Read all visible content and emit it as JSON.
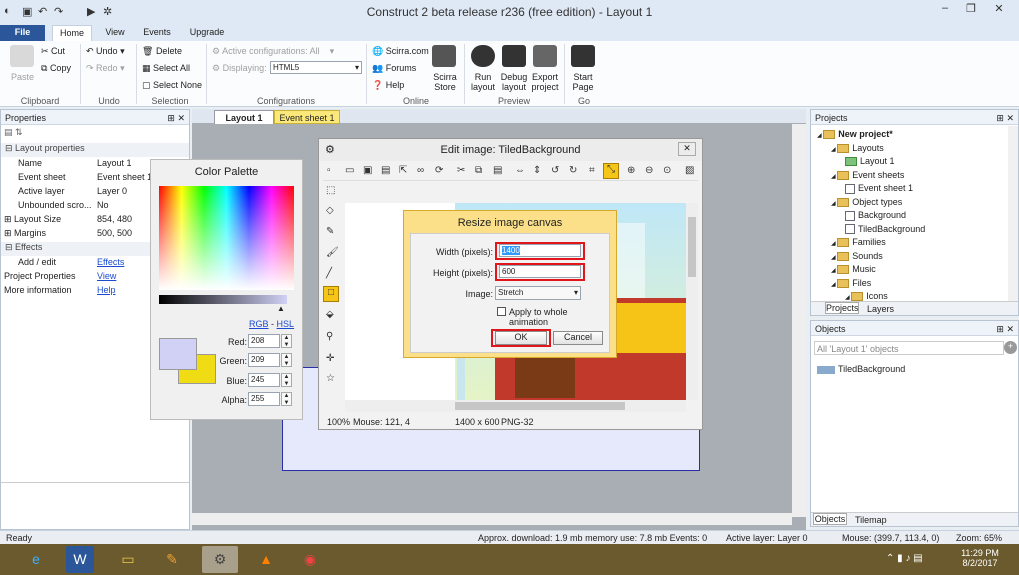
{
  "window": {
    "title": "Construct 2 beta release r236  (free edition) - Layout 1",
    "min": "–",
    "max": "❐",
    "close": "✕"
  },
  "menu_tabs": [
    "File",
    "Home",
    "View",
    "Events",
    "Upgrade"
  ],
  "ribbon": {
    "clipboard": {
      "paste": "Paste",
      "cut": "Cut",
      "copy": "Copy",
      "group": "Clipboard"
    },
    "undo": {
      "undo": "Undo",
      "redo": "Redo",
      "group": "Undo"
    },
    "selection": {
      "delete": "Delete",
      "select_all": "Select All",
      "select_none": "Select None",
      "group": "Selection"
    },
    "configurations": {
      "active_label": "Active configurations: All",
      "displaying_label": "Displaying:",
      "displaying_value": "HTML5",
      "group": "Configurations"
    },
    "online": {
      "scirra": "Scirra.com",
      "forums": "Forums",
      "help": "Help",
      "store": "Scirra Store",
      "group": "Online"
    },
    "preview": {
      "run": "Run layout",
      "debug": "Debug layout",
      "export": "Export project",
      "group": "Preview"
    },
    "go": {
      "start": "Start Page",
      "group": "Go"
    }
  },
  "properties": {
    "header": "Properties",
    "section_layout": "Layout properties",
    "rows": [
      {
        "name": "Name",
        "value": "Layout 1"
      },
      {
        "name": "Event sheet",
        "value": "Event sheet 1"
      },
      {
        "name": "Active layer",
        "value": "Layer 0"
      },
      {
        "name": "Unbounded scro...",
        "value": "No"
      },
      {
        "name": "Layout Size",
        "value": "854, 480"
      },
      {
        "name": "Margins",
        "value": "500, 500"
      }
    ],
    "section_effects": "Effects",
    "add_edit": "Add / edit",
    "effects_link": "Effects",
    "project_props": "Project Properties",
    "view_link": "View",
    "more_info": "More information",
    "help_link": "Help"
  },
  "doc_tabs": [
    "Layout 1",
    "Event sheet 1"
  ],
  "color_palette": {
    "title": "Color Palette",
    "rgb_link": "RGB",
    "sep": "-",
    "hsl_link": "HSL",
    "red_label": "Red:",
    "red": "208",
    "green_label": "Green:",
    "green": "209",
    "blue_label": "Blue:",
    "blue": "245",
    "alpha_label": "Alpha:",
    "alpha": "255",
    "primary_color": "#d0d1f5",
    "secondary_color": "#f0dc14"
  },
  "edit_image": {
    "title": "Edit image: TiledBackground",
    "status_zoom": "100%",
    "status_mouse": "Mouse: 121, 4",
    "status_size": "1400 x 600",
    "status_format": "PNG-32"
  },
  "resize_dialog": {
    "title": "Resize image canvas",
    "width_label": "Width (pixels):",
    "width_value": "1400",
    "height_label": "Height (pixels):",
    "height_value": "600",
    "image_label": "Image:",
    "image_value": "Stretch",
    "apply_anim": "Apply to whole animation",
    "ok": "OK",
    "cancel": "Cancel"
  },
  "projects": {
    "header": "Projects",
    "tree": [
      {
        "label": "New project*",
        "bold": true,
        "indent": 0,
        "icon": "folder-icon"
      },
      {
        "label": "Layouts",
        "indent": 1,
        "icon": "folder-icon"
      },
      {
        "label": "Layout 1",
        "indent": 2,
        "icon": "layout-icon"
      },
      {
        "label": "Event sheets",
        "indent": 1,
        "icon": "folder-icon"
      },
      {
        "label": "Event sheet 1",
        "indent": 2,
        "icon": "event-sheet-icon"
      },
      {
        "label": "Object types",
        "indent": 1,
        "icon": "folder-icon"
      },
      {
        "label": "Background",
        "indent": 2,
        "icon": "object-icon"
      },
      {
        "label": "TiledBackground",
        "indent": 2,
        "icon": "object-icon"
      },
      {
        "label": "Families",
        "indent": 1,
        "icon": "folder-icon"
      },
      {
        "label": "Sounds",
        "indent": 1,
        "icon": "folder-icon"
      },
      {
        "label": "Music",
        "indent": 1,
        "icon": "folder-icon"
      },
      {
        "label": "Files",
        "indent": 1,
        "icon": "folder-icon"
      },
      {
        "label": "Icons",
        "indent": 2,
        "icon": "folder-icon"
      }
    ],
    "tabs": [
      "Projects",
      "Layers"
    ]
  },
  "objects": {
    "header": "Objects",
    "filter": "All 'Layout 1' objects",
    "items": [
      "TiledBackground"
    ],
    "tabs": [
      "Objects",
      "Tilemap"
    ]
  },
  "statusbar": {
    "ready": "Ready",
    "download": "Approx. download: 1.9 mb  memory use: 7.8 mb  Events: 0",
    "layer": "Active layer: Layer 0",
    "mouse": "Mouse: (399.7, 113.4, 0)",
    "zoom": "Zoom: 65%"
  },
  "taskbar": {
    "time": "11:29 PM",
    "date": "8/2/2017",
    "apps": [
      "internet-explorer-icon",
      "word-icon",
      "file-explorer-icon",
      "paint-icon",
      "construct-icon",
      "vlc-icon",
      "chrome-icon"
    ]
  }
}
